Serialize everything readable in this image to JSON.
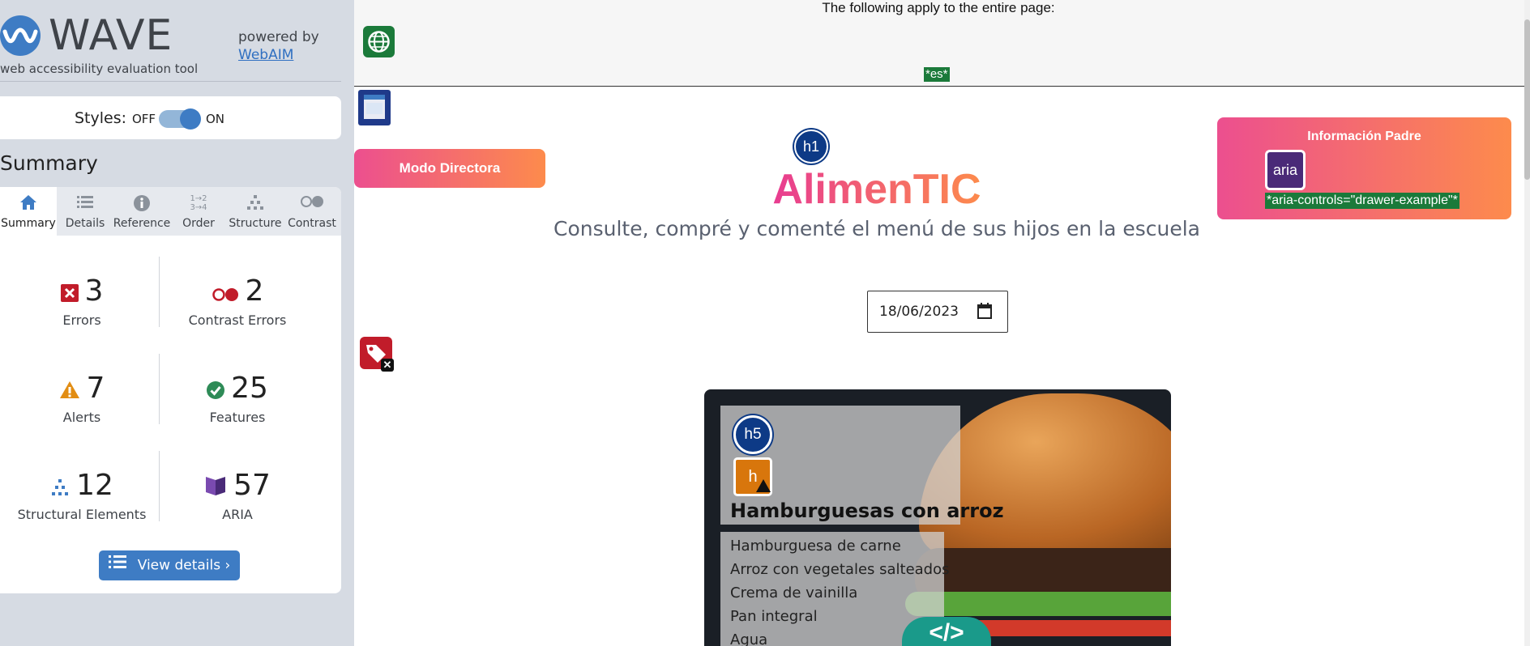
{
  "wave": {
    "logo_text": "WAVE",
    "subtitle": "web accessibility evaluation tool",
    "powered_by": "powered by",
    "webaim_link": "WebAIM",
    "styles_label": "Styles:",
    "styles_off": "OFF",
    "styles_on": "ON",
    "styles_enabled": true,
    "summary_title": "Summary",
    "tabs": [
      {
        "label": "Summary",
        "icon": "home-icon",
        "active": true
      },
      {
        "label": "Details",
        "icon": "list-icon",
        "active": false
      },
      {
        "label": "Reference",
        "icon": "info-icon",
        "active": false
      },
      {
        "label": "Order",
        "icon": "order-icon",
        "active": false
      },
      {
        "label": "Structure",
        "icon": "structure-icon",
        "active": false
      },
      {
        "label": "Contrast",
        "icon": "contrast-icon",
        "active": false
      }
    ],
    "stats": {
      "errors": {
        "value": "3",
        "label": "Errors",
        "color": "#c11c2a"
      },
      "contrast_errors": {
        "value": "2",
        "label": "Contrast Errors",
        "color": "#c11c2a"
      },
      "alerts": {
        "value": "7",
        "label": "Alerts",
        "color": "#e28d13"
      },
      "features": {
        "value": "25",
        "label": "Features",
        "color": "#2e8b57"
      },
      "structural": {
        "value": "12",
        "label": "Structural Elements",
        "color": "#3e7cc4"
      },
      "aria": {
        "value": "57",
        "label": "ARIA",
        "color": "#5a2d82"
      }
    },
    "view_details": "View details ›"
  },
  "page": {
    "banner_text": "The following apply to the entire page:",
    "lang_tag": "*es*",
    "modo_button": "Modo Directora",
    "h1_badge": "h1",
    "title": "AlimenTIC",
    "tagline": "Consulte, compré y comenté el menú de sus hijos en la escuela",
    "info_button": "Información Padre",
    "aria_badge": "aria",
    "aria_tag": "*aria-controls=\"drawer-example\"*",
    "date_value": "18/06/2023",
    "card": {
      "h5_badge": "h5",
      "h_badge": "h",
      "title": "Hamburguesas con arroz",
      "menu": [
        "Hamburguesa de carne",
        "Arroz con vegetales salteados",
        "Crema de vainilla",
        "Pan integral",
        "Agua"
      ],
      "code_badge": "</>"
    }
  },
  "colors": {
    "wave_blue": "#3e7cc4",
    "gradient_start": "#ec4f8f",
    "gradient_end": "#fd8b4c",
    "tag_green": "#1b7a3a"
  }
}
